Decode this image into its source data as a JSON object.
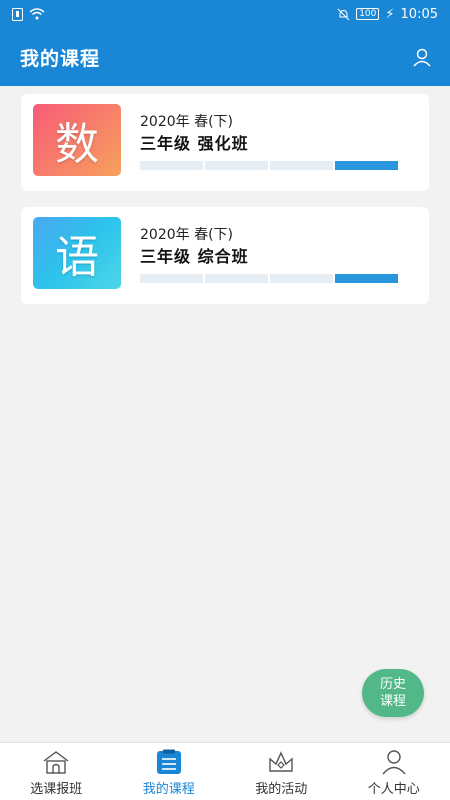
{
  "statusbar": {
    "time": "10:05",
    "battery": "100"
  },
  "header": {
    "title": "我的课程"
  },
  "courses": [
    {
      "thumb_char": "数",
      "term": "2020年  春(下)",
      "name": "三年级  强化班",
      "progress_segments": 4,
      "progress_filled": 1
    },
    {
      "thumb_char": "语",
      "term": "2020年  春(下)",
      "name": "三年级  综合班",
      "progress_segments": 4,
      "progress_filled": 1
    }
  ],
  "fab": {
    "line1": "历史",
    "line2": "课程"
  },
  "tabs": [
    {
      "label": "选课报班",
      "icon": "house-icon",
      "active": false
    },
    {
      "label": "我的课程",
      "icon": "clipboard-icon",
      "active": true
    },
    {
      "label": "我的活动",
      "icon": "crown-icon",
      "active": false
    },
    {
      "label": "个人中心",
      "icon": "user-icon",
      "active": false
    }
  ],
  "colors": {
    "primary": "#1a86d6",
    "fab": "#52b888",
    "progress_on": "#2a96dd",
    "progress_off": "#e6edf3"
  }
}
